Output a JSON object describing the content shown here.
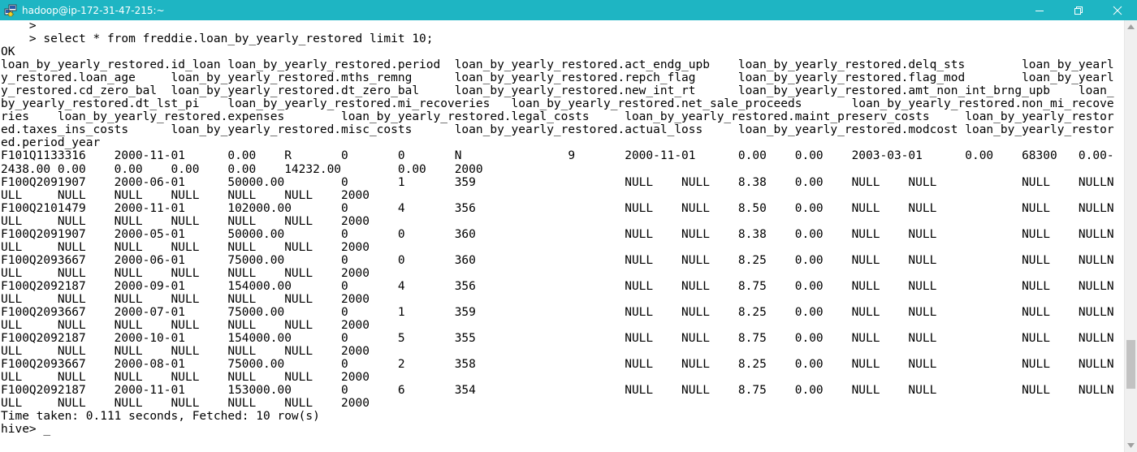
{
  "window": {
    "title": "hadoop@ip-172-31-47-215:~",
    "icon": "putty-icon",
    "controls": [
      "minimize-icon",
      "maximize-icon",
      "close-icon"
    ],
    "titlebar_color": "#1eb5c3"
  },
  "terminal": {
    "lines": [
      "    >",
      "    > select * from freddie.loan_by_yearly_restored limit 10;",
      "OK",
      "loan_by_yearly_restored.id_loan loan_by_yearly_restored.period  loan_by_yearly_restored.act_endg_upb    loan_by_yearly_restored.delq_sts        loan_by_yearl",
      "y_restored.loan_age     loan_by_yearly_restored.mths_remng      loan_by_yearly_restored.repch_flag      loan_by_yearly_restored.flag_mod        loan_by_yearl",
      "y_restored.cd_zero_bal  loan_by_yearly_restored.dt_zero_bal     loan_by_yearly_restored.new_int_rt      loan_by_yearly_restored.amt_non_int_brng_upb    loan_",
      "by_yearly_restored.dt_lst_pi    loan_by_yearly_restored.mi_recoveries   loan_by_yearly_restored.net_sale_proceeds       loan_by_yearly_restored.non_mi_recove",
      "ries    loan_by_yearly_restored.expenses        loan_by_yearly_restored.legal_costs     loan_by_yearly_restored.maint_preserv_costs     loan_by_yearly_restor",
      "ed.taxes_ins_costs      loan_by_yearly_restored.misc_costs      loan_by_yearly_restored.actual_loss     loan_by_yearly_restored.modcost loan_by_yearly_restor",
      "ed.period_year",
      "F101Q1133316    2000-11-01      0.00    R       0       0       N               9       2000-11-01      0.00    0.00    2003-03-01      0.00    68300   0.00-",
      "2438.00 0.00    0.00    0.00    0.00    14232.00        0.00    2000",
      "F100Q2091907    2000-06-01      50000.00        0       1       359                     NULL    NULL    8.38    0.00    NULL    NULL            NULL    NULLN",
      "ULL     NULL    NULL    NULL    NULL    NULL    2000",
      "F100Q2101479    2000-11-01      102000.00       0       4       356                     NULL    NULL    8.50    0.00    NULL    NULL            NULL    NULLN",
      "ULL     NULL    NULL    NULL    NULL    NULL    2000",
      "F100Q2091907    2000-05-01      50000.00        0       0       360                     NULL    NULL    8.38    0.00    NULL    NULL            NULL    NULLN",
      "ULL     NULL    NULL    NULL    NULL    NULL    2000",
      "F100Q2093667    2000-06-01      75000.00        0       0       360                     NULL    NULL    8.25    0.00    NULL    NULL            NULL    NULLN",
      "ULL     NULL    NULL    NULL    NULL    NULL    2000",
      "F100Q2092187    2000-09-01      154000.00       0       4       356                     NULL    NULL    8.75    0.00    NULL    NULL            NULL    NULLN",
      "ULL     NULL    NULL    NULL    NULL    NULL    2000",
      "F100Q2093667    2000-07-01      75000.00        0       1       359                     NULL    NULL    8.25    0.00    NULL    NULL            NULL    NULLN",
      "ULL     NULL    NULL    NULL    NULL    NULL    2000",
      "F100Q2092187    2000-10-01      154000.00       0       5       355                     NULL    NULL    8.75    0.00    NULL    NULL            NULL    NULLN",
      "ULL     NULL    NULL    NULL    NULL    NULL    2000",
      "F100Q2093667    2000-08-01      75000.00        0       2       358                     NULL    NULL    8.25    0.00    NULL    NULL            NULL    NULLN",
      "ULL     NULL    NULL    NULL    NULL    NULL    2000",
      "F100Q2092187    2000-11-01      153000.00       0       6       354                     NULL    NULL    8.75    0.00    NULL    NULL            NULL    NULLN",
      "ULL     NULL    NULL    NULL    NULL    NULL    2000",
      "Time taken: 0.111 seconds, Fetched: 10 row(s)"
    ],
    "prompt": "hive> ",
    "cursor": "_",
    "scrollbar": {
      "position": 0.86,
      "visible_fraction": 0.12
    }
  }
}
